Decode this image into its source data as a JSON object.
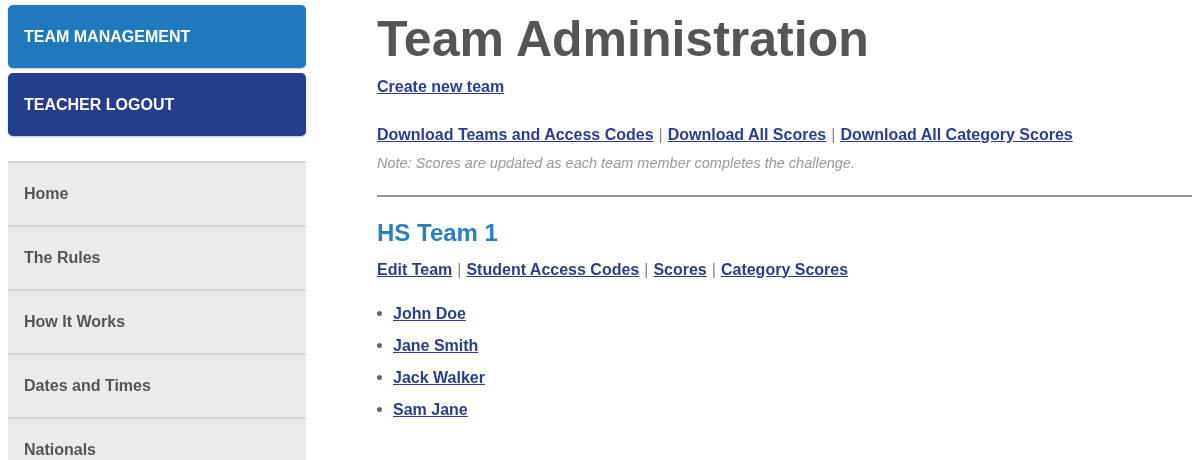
{
  "sidebar": {
    "buttons": [
      {
        "label": "TEAM MANAGEMENT",
        "kind": "primary"
      },
      {
        "label": "TEACHER LOGOUT",
        "kind": "secondary"
      }
    ],
    "items": [
      {
        "label": "Home"
      },
      {
        "label": "The Rules"
      },
      {
        "label": "How It Works"
      },
      {
        "label": "Dates and Times"
      },
      {
        "label": "Nationals"
      }
    ]
  },
  "main": {
    "title": "Team Administration",
    "create_link": "Create new team",
    "downloads": [
      {
        "kind": "link",
        "text": "Download Teams and Access Codes"
      },
      {
        "kind": "separator",
        "text": "|"
      },
      {
        "kind": "link",
        "text": "Download All Scores"
      },
      {
        "kind": "separator",
        "text": "|"
      },
      {
        "kind": "link",
        "text": "Download All Category Scores"
      }
    ],
    "note": "Note: Scores are updated as each team member completes the challenge.",
    "teams": [
      {
        "name": "HS Team 1",
        "actions": [
          {
            "kind": "link",
            "text": "Edit Team"
          },
          {
            "kind": "separator",
            "text": "|"
          },
          {
            "kind": "link",
            "text": "Student Access Codes"
          },
          {
            "kind": "separator",
            "text": "|"
          },
          {
            "kind": "link",
            "text": "Scores"
          },
          {
            "kind": "separator",
            "text": "|"
          },
          {
            "kind": "link",
            "text": "Category Scores"
          }
        ],
        "members": [
          "John Doe",
          "Jane Smith",
          "Jack Walker",
          "Sam Jane"
        ]
      }
    ]
  }
}
